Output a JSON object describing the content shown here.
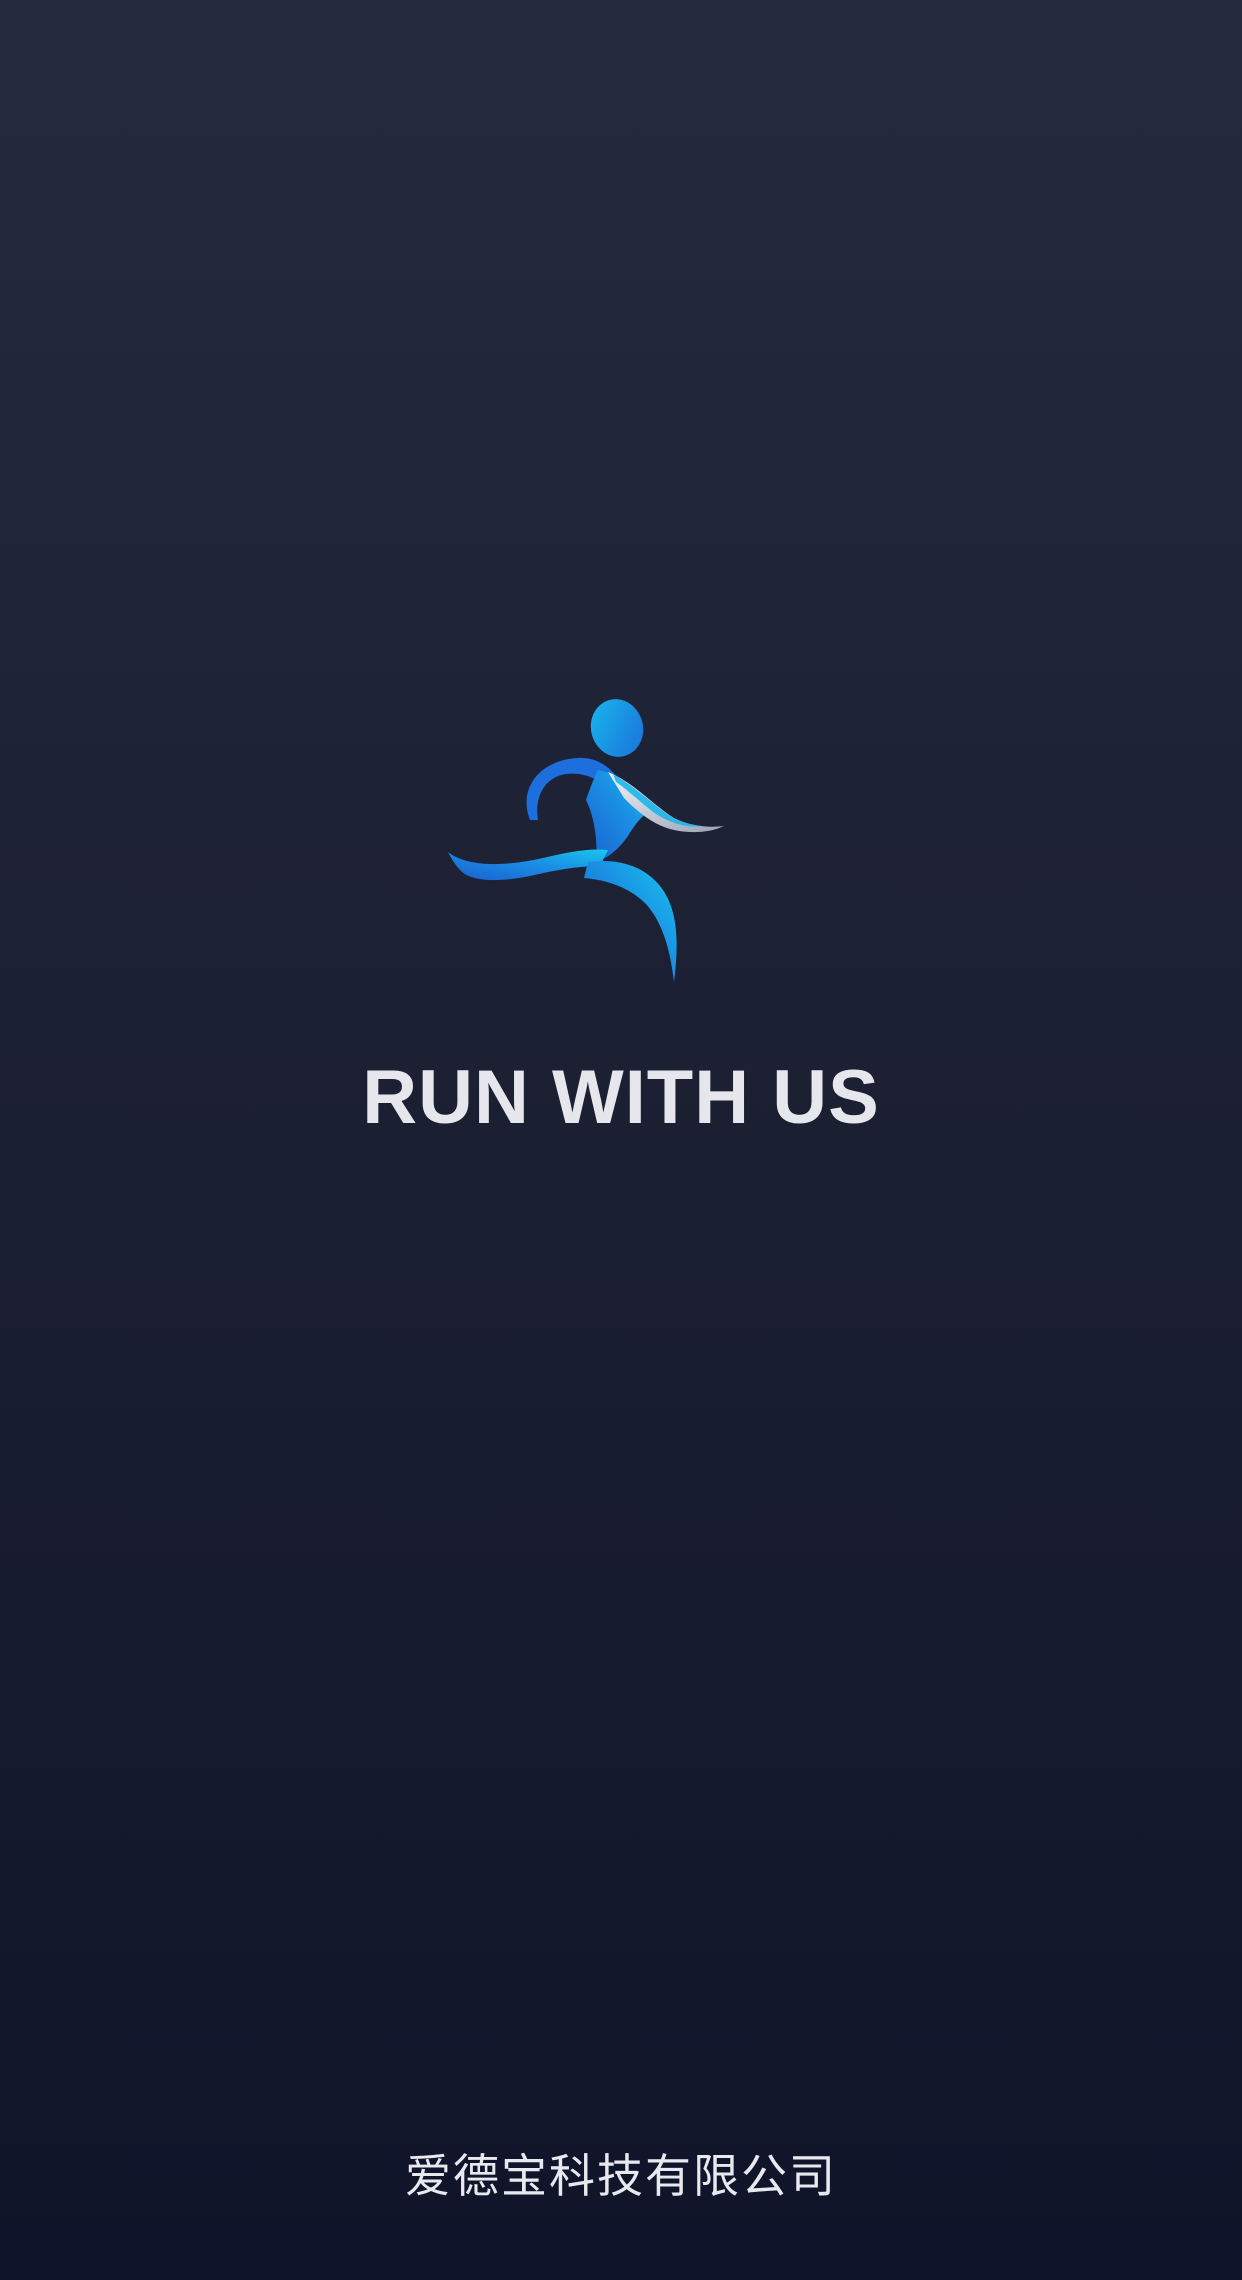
{
  "splash": {
    "logo_icon": "runner-icon",
    "tagline": "RUN WITH US",
    "company": "爱德宝科技有限公司"
  },
  "colors": {
    "background_top": "#262a3f",
    "background_bottom": "#10142a",
    "logo_blue_dark": "#1a63d6",
    "logo_blue_light": "#18c6ee",
    "logo_highlight": "#d8dce6",
    "text": "#e6e7ec"
  }
}
